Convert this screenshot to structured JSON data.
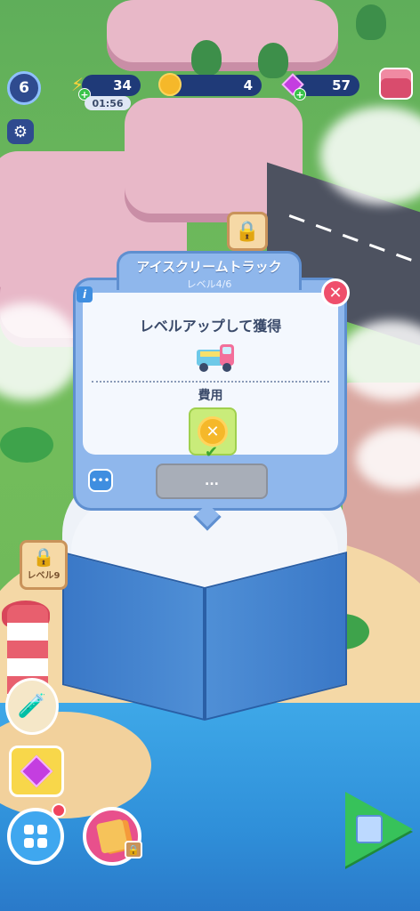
{
  "hud": {
    "player_level": "6",
    "energy": "34",
    "energy_timer": "01:56",
    "coins": "4",
    "gems": "57",
    "icons": {
      "settings": "gear-icon",
      "energy": "lightning-icon",
      "coin": "coin-icon",
      "gem": "gem-icon",
      "shop": "chest-icon"
    }
  },
  "popup": {
    "title": "アイスクリームトラック",
    "subtitle": "レベル4/6",
    "unlock_label": "レベルアップして獲得",
    "cost_label": "費用",
    "action_button": "...",
    "info_label": "i",
    "close_label": "✕"
  },
  "map": {
    "locked_area_label": "レベル9"
  },
  "colors": {
    "accent_blue": "#8fb7ec",
    "close_red": "#ef4f6b",
    "coin_gold": "#f5b82a",
    "play_green": "#37c25a"
  }
}
